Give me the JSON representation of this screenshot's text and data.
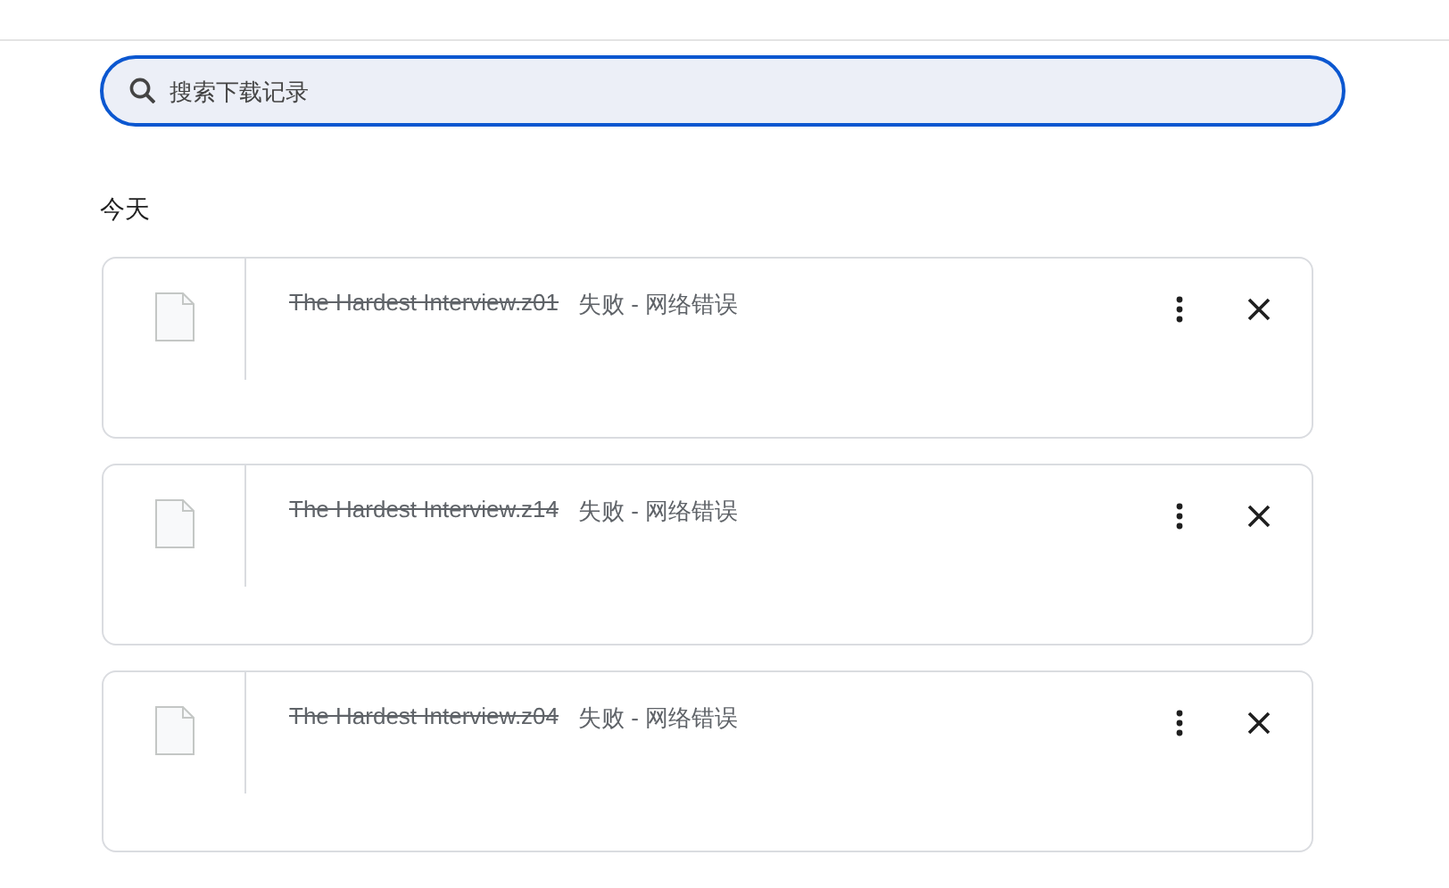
{
  "search": {
    "placeholder": "搜索下载记录"
  },
  "section": "今天",
  "downloads": [
    {
      "file_name": "The Hardest Interview.z01",
      "status": "失败 - 网络错误",
      "failed": true
    },
    {
      "file_name": "The Hardest Interview.z14",
      "status": "失败 - 网络错误",
      "failed": true
    },
    {
      "file_name": "The Hardest Interview.z04",
      "status": "失败 - 网络错误",
      "failed": true
    }
  ]
}
